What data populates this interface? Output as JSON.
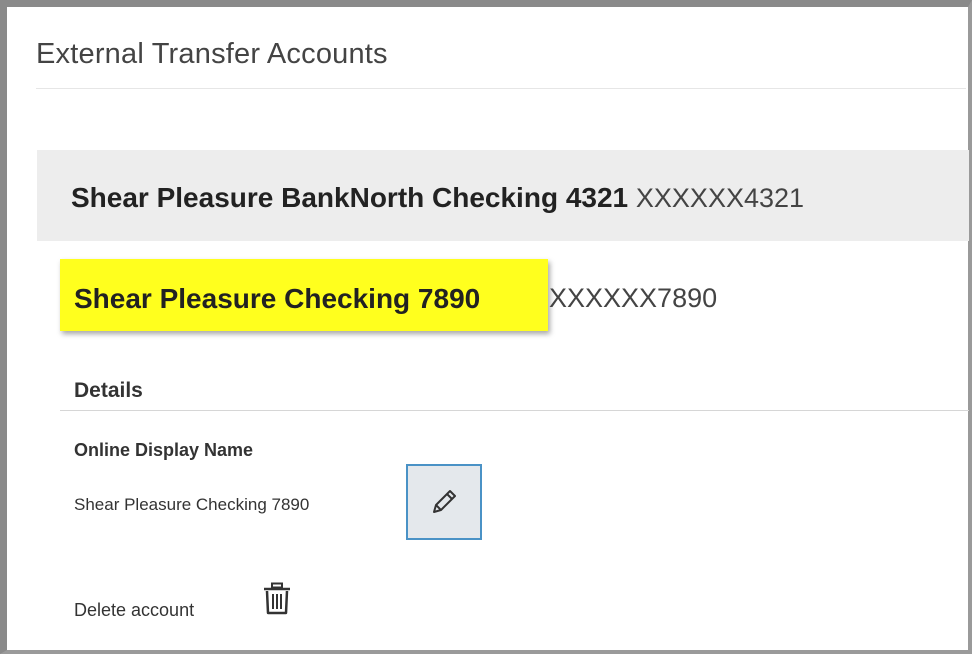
{
  "page": {
    "title": "External Transfer Accounts"
  },
  "accounts": [
    {
      "name": "Shear Pleasure BankNorth Checking 4321",
      "masked_number": "XXXXXX4321"
    },
    {
      "name": "Shear Pleasure Checking 7890",
      "masked_number": "XXXXXX7890",
      "highlight_color": "#ffff1e"
    }
  ],
  "details": {
    "heading": "Details",
    "display_name_label": "Online Display Name",
    "display_name_value": "Shear Pleasure Checking 7890",
    "edit_icon": "pencil-icon",
    "delete_label": "Delete account",
    "delete_icon": "trash-icon"
  },
  "colors": {
    "row_background": "#ededed",
    "edit_button_border": "#4a92c6",
    "highlight": "#ffff1e"
  }
}
